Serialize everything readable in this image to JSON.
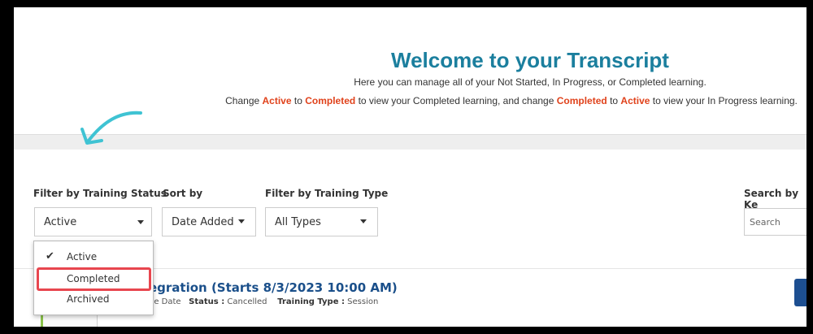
{
  "header": {
    "title": "Welcome to your Transcript",
    "line1": "Here you can manage all of your Not Started, In Progress, or Completed learning.",
    "line2": {
      "p1": "Change ",
      "w1": "Active",
      "p2": " to ",
      "w2": "Completed",
      "p3": " to view your Completed learning, and change ",
      "w3": "Completed",
      "p4": " to ",
      "w4": "Active",
      "p5": " to view your In Progress learning."
    }
  },
  "filters": {
    "status_label": "Filter by Training Status",
    "status_value": "Active",
    "sort_label": "Sort by",
    "sort_value": "Date Added",
    "type_label": "Filter by Training Type",
    "type_value": "All Types",
    "search_label": "Search by Ke",
    "search_placeholder": "Search"
  },
  "status_dropdown": {
    "options": [
      "Active",
      "Completed",
      "Archived"
    ],
    "selected": "Active",
    "highlighted": "Completed"
  },
  "row": {
    "title": "egration (Starts 8/3/2023 10:00 AM)",
    "due": "ue Date",
    "status_label": "Status :",
    "status_value": "Cancelled",
    "type_label": "Training Type :",
    "type_value": "Session"
  },
  "colors": {
    "title": "#1b7f9e",
    "highlight_text": "#e0421b",
    "annotation_red": "#e8464f",
    "arrow": "#3fc3d3",
    "link": "#1a4f8a",
    "button": "#1d4f91"
  }
}
